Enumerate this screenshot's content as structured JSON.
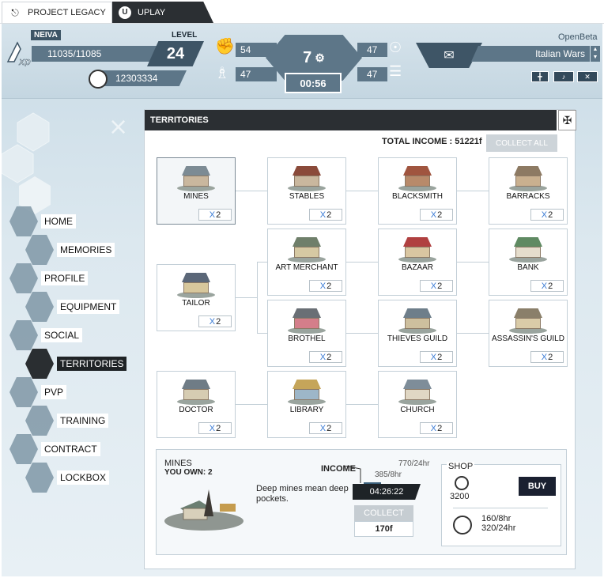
{
  "tabs": [
    {
      "label": "PROJECT LEGACY",
      "icon": "project-legacy-icon"
    },
    {
      "label": "UPLAY",
      "icon": "uplay-icon"
    }
  ],
  "header": {
    "player_name": "NEIVA",
    "xp": "11035/11085",
    "level_label": "LEVEL",
    "level": "24",
    "money": "12303334",
    "stat_left_top": "54",
    "stat_left_bottom": "47",
    "ap": "7",
    "timer": "00:56",
    "stat_right_top": "47",
    "stat_right_bottom": "47",
    "openbeta": "OpenBeta",
    "server": "Italian Wars",
    "colors": {
      "accent": "#5d7688",
      "dark": "#2b2f33",
      "link": "#3a7bd5"
    }
  },
  "sidebar": {
    "items": [
      {
        "label": "HOME"
      },
      {
        "label": "MEMORIES"
      },
      {
        "label": "PROFILE"
      },
      {
        "label": "EQUIPMENT"
      },
      {
        "label": "SOCIAL"
      },
      {
        "label": "TERRITORIES"
      },
      {
        "label": "PVP"
      },
      {
        "label": "TRAINING"
      },
      {
        "label": "CONTRACT"
      },
      {
        "label": "LOCKBOX"
      }
    ],
    "active": "TERRITORIES"
  },
  "panel": {
    "title": "TERRITORIES",
    "total_income": "TOTAL INCOME : 51221f",
    "collect_all": "COLLECT ALL",
    "buildings": [
      {
        "name": "MINES",
        "mult": "2"
      },
      {
        "name": "STABLES",
        "mult": "2"
      },
      {
        "name": "BLACKSMITH",
        "mult": "2"
      },
      {
        "name": "BARRACKS",
        "mult": "2"
      },
      {
        "name": "ART MERCHANT",
        "mult": "2"
      },
      {
        "name": "BAZAAR",
        "mult": "2"
      },
      {
        "name": "BANK",
        "mult": "2"
      },
      {
        "name": "TAILOR",
        "mult": "2"
      },
      {
        "name": "BROTHEL",
        "mult": "2"
      },
      {
        "name": "THIEVES GUILD",
        "mult": "2"
      },
      {
        "name": "ASSASSIN'S GUILD",
        "mult": "2"
      },
      {
        "name": "DOCTOR",
        "mult": "2"
      },
      {
        "name": "LIBRARY",
        "mult": "2"
      },
      {
        "name": "CHURCH",
        "mult": "2"
      }
    ],
    "mult_prefix": "X"
  },
  "detail": {
    "name": "MINES",
    "own": "YOU OWN: 2",
    "desc": "Deep mines mean deep pockets.",
    "income_label": "INCOME",
    "rate_24": "770/24hr",
    "rate_8": "385/8hr",
    "timer": "04:26:22",
    "collect": "COLLECT",
    "collect_value": "170f",
    "shop_title": "SHOP",
    "price": "3200",
    "buy": "BUY",
    "bonus_8": "160/8hr",
    "bonus_24": "320/24hr"
  }
}
